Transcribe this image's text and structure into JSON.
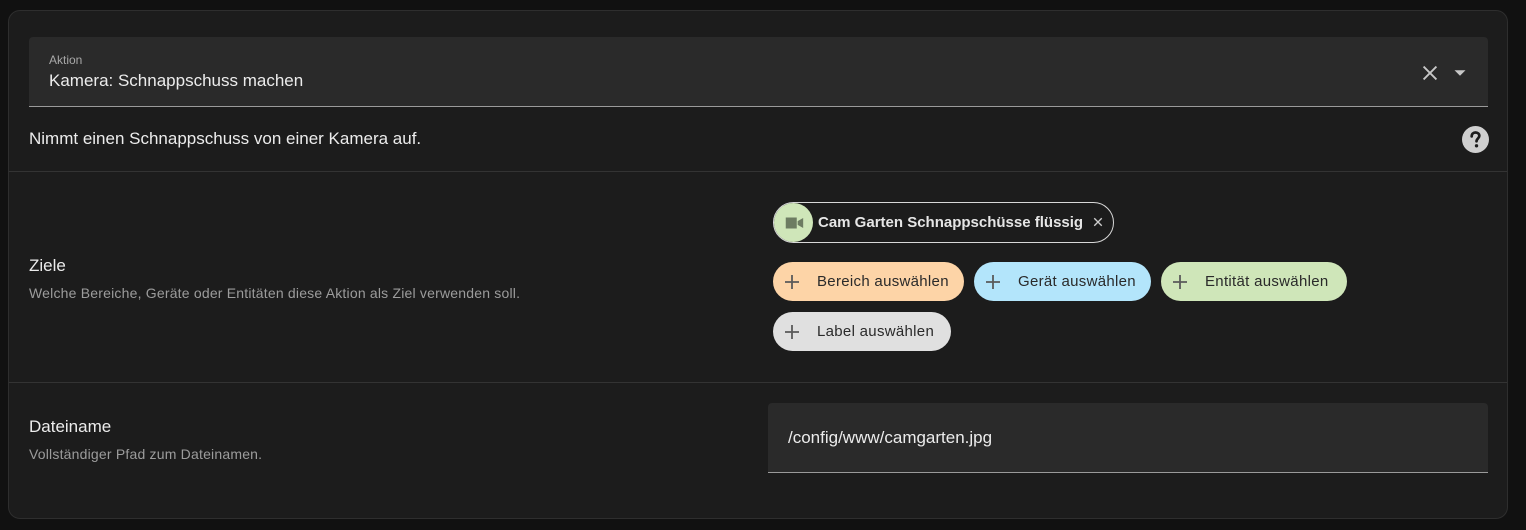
{
  "action": {
    "label": "Aktion",
    "value": "Kamera: Schnappschuss machen",
    "description": "Nimmt einen Schnappschuss von einer Kamera auf."
  },
  "targets": {
    "title": "Ziele",
    "subtitle": "Welche Bereiche, Geräte oder Entitäten diese Aktion als Ziel verwenden soll.",
    "selected_entity": {
      "label": "Cam Garten Schnappschüsse flüssig",
      "icon": "video-camera-icon"
    },
    "pickers": [
      {
        "label": "Bereich auswählen",
        "color": "#fdd4a7"
      },
      {
        "label": "Gerät auswählen",
        "color": "#b3e5fb"
      },
      {
        "label": "Entität auswählen",
        "color": "#cfe6b9"
      },
      {
        "label": "Label auswählen",
        "color": "#e0e0e0"
      }
    ]
  },
  "filename": {
    "title": "Dateiname",
    "subtitle": "Vollständiger Pfad zum Dateinamen.",
    "value": "/config/www/camgarten.jpg"
  }
}
